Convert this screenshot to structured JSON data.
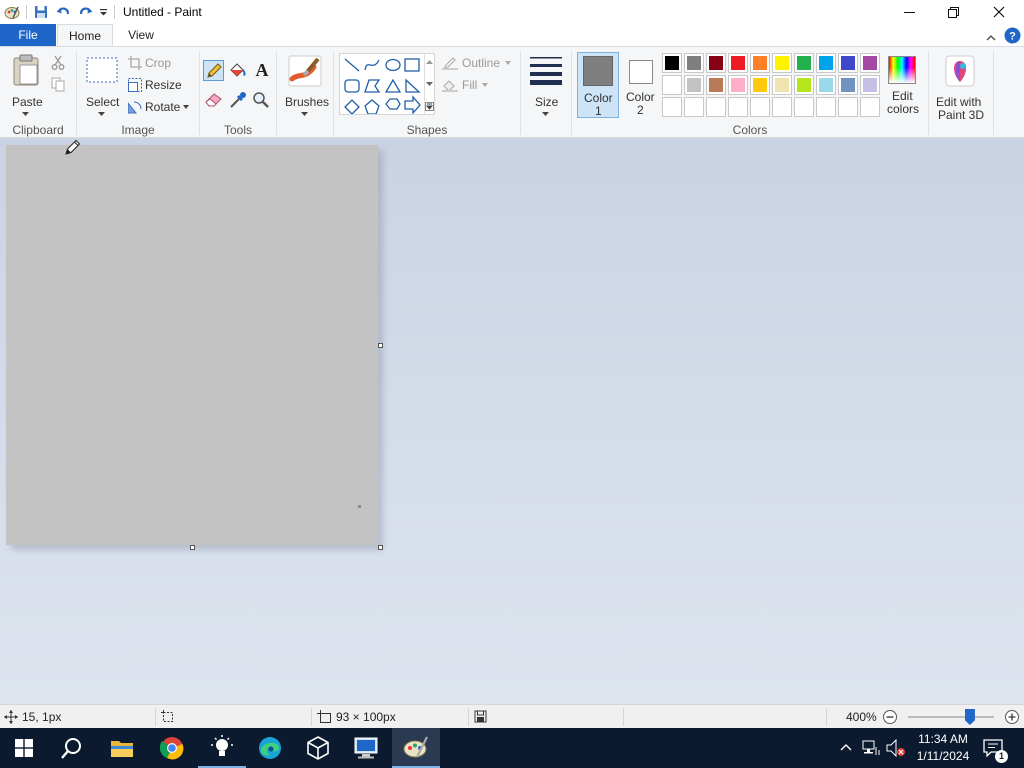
{
  "window": {
    "title": "Untitled - Paint"
  },
  "tabs": {
    "file": "File",
    "home": "Home",
    "view": "View"
  },
  "clipboard": {
    "paste": "Paste",
    "group": "Clipboard"
  },
  "image": {
    "select": "Select",
    "crop": "Crop",
    "resize": "Resize",
    "rotate": "Rotate",
    "group": "Image"
  },
  "tools": {
    "group": "Tools",
    "text_tool_glyph": "A"
  },
  "brushes": {
    "label": "Brushes"
  },
  "shapes": {
    "outline": "Outline",
    "fill": "Fill",
    "group": "Shapes"
  },
  "size": {
    "label": "Size"
  },
  "colors": {
    "color1_line1": "Color",
    "color1_line2": "1",
    "color2_line1": "Color",
    "color2_line2": "2",
    "edit_line1": "Edit",
    "edit_line2": "colors",
    "group": "Colors",
    "color1_value": "#7f7f7f",
    "color2_value": "#ffffff",
    "palette_row1": [
      "#000000",
      "#7f7f7f",
      "#880015",
      "#ed1c24",
      "#ff7f27",
      "#fff200",
      "#22b14c",
      "#00a2e8",
      "#3f48cc",
      "#a349a4"
    ],
    "palette_row2": [
      "#ffffff",
      "#c3c3c3",
      "#b97a57",
      "#ffaec9",
      "#ffc90e",
      "#efe4b0",
      "#b5e61d",
      "#99d9ea",
      "#7092be",
      "#c8bfe7"
    ]
  },
  "paint3d": {
    "line1": "Edit with",
    "line2": "Paint 3D"
  },
  "canvas": {
    "fill_color": "#c3c3c3"
  },
  "status": {
    "cursor_pos": "15, 1px",
    "image_size": "93 × 100px",
    "zoom": "400%",
    "zoom_level_fraction": 0.72
  },
  "taskbar": {
    "time": "11:34 AM",
    "date": "1/11/2024",
    "notifications_count": "1"
  }
}
